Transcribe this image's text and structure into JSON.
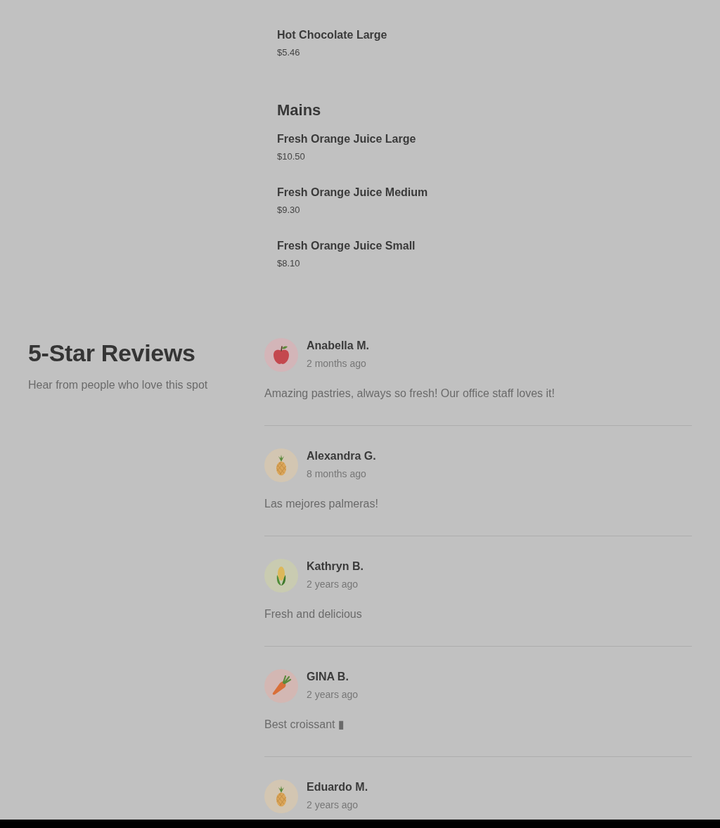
{
  "menu": {
    "sections": [
      {
        "items": [
          {
            "name": "Hot Chocolate Large",
            "price": "$5.46"
          }
        ]
      },
      {
        "title": "Mains",
        "items": [
          {
            "name": "Fresh Orange Juice Large",
            "price": "$10.50"
          },
          {
            "name": "Fresh Orange Juice Medium",
            "price": "$9.30"
          },
          {
            "name": "Fresh Orange Juice Small",
            "price": "$8.10"
          }
        ]
      }
    ]
  },
  "reviews": {
    "title": "5-Star Reviews",
    "subtitle": "Hear from people who love this spot",
    "items": [
      {
        "author": "Anabella M.",
        "time": "2 months ago",
        "avatar": {
          "kind": "apple"
        },
        "text": "Amazing pastries, always so fresh! Our office staff loves it!"
      },
      {
        "author": "Alexandra G.",
        "time": "8 months ago",
        "avatar": {
          "kind": "pineapple"
        },
        "text": "Las mejores palmeras!"
      },
      {
        "author": "Kathryn B.",
        "time": "2 years ago",
        "avatar": {
          "kind": "corn"
        },
        "text": "Fresh and delicious"
      },
      {
        "author": "GINA B.",
        "time": "2 years ago",
        "avatar": {
          "kind": "carrot"
        },
        "text": "Best croissant ▮"
      },
      {
        "author": "Eduardo M.",
        "time": "2 years ago",
        "avatar": {
          "kind": "pineapple"
        }
      }
    ]
  }
}
